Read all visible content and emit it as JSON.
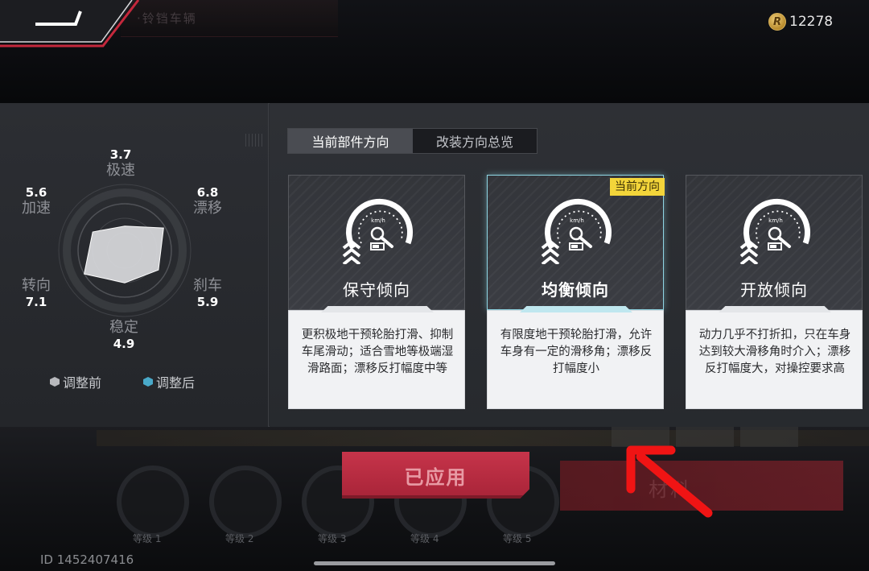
{
  "header": {
    "background_tab_text": "·铃铛车辆",
    "currency": {
      "icon": "coin-icon",
      "symbol": "R",
      "amount": "12278"
    }
  },
  "radar": {
    "stats": {
      "top_speed": {
        "label": "极速",
        "value": "3.7"
      },
      "drift": {
        "label": "漂移",
        "value": "6.8"
      },
      "braking": {
        "label": "刹车",
        "value": "5.9"
      },
      "stability": {
        "label": "稳定",
        "value": "4.9"
      },
      "steering": {
        "label": "转向",
        "value": "7.1"
      },
      "acceleration": {
        "label": "加速",
        "value": "5.6"
      }
    },
    "legend": {
      "before": {
        "label": "调整前",
        "color": "#b8b9bd"
      },
      "after": {
        "label": "调整后",
        "color": "#49a9c9"
      }
    }
  },
  "tabs": [
    {
      "label": "当前部件方向",
      "active": true
    },
    {
      "label": "改装方向总览",
      "active": false
    }
  ],
  "cards": [
    {
      "title": "保守倾向",
      "icon": "speedometer-icon",
      "description": "更积极地干预轮胎打滑、抑制车尾滑动；适合雪地等极端湿滑路面；漂移反打幅度中等",
      "selected": false
    },
    {
      "title": "均衡倾向",
      "icon": "speedometer-icon",
      "description": "有限度地干预轮胎打滑，允许车身有一定的滑移角；漂移反打幅度小",
      "selected": true,
      "badge": "当前方向"
    },
    {
      "title": "开放倾向",
      "icon": "speedometer-icon",
      "description": "动力几乎不打折扣，只在车身达到较大滑移角时介入；漂移反打幅度大，对操控要求高",
      "selected": false
    }
  ],
  "apply_button": {
    "label": "已应用"
  },
  "background": {
    "dial_labels": [
      "等级 1",
      "等级 2",
      "等级 3",
      "等级 4",
      "等级 5"
    ],
    "red_button_text": "材料"
  },
  "footer": {
    "player_id": "ID 1452407416"
  },
  "colors": {
    "accent_red": "#c6344a",
    "badge_yellow": "#f3d53a",
    "selected_glow": "#8fd6e4",
    "radar_fill": "#d9dadd"
  }
}
